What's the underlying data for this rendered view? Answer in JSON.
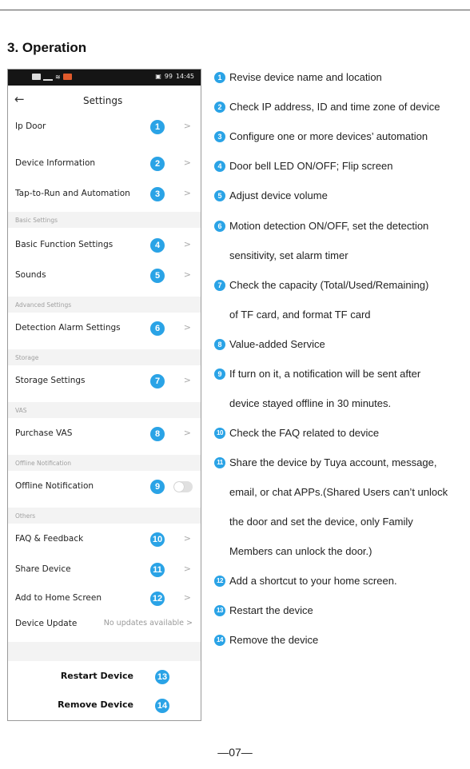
{
  "section_title": "3. Operation",
  "phone": {
    "status_time": "14:45",
    "status_battery": "99",
    "nav_back": "←",
    "nav_title": "Settings",
    "chevron": ">",
    "rows": {
      "ip_door": "Ip Door",
      "device_info": "Device Information",
      "tap_to_run": "Tap-to-Run and Automation",
      "basic_function": "Basic Function Settings",
      "sounds": "Sounds",
      "detection_alarm": "Detection Alarm Settings",
      "storage_settings": "Storage Settings",
      "purchase_vas": "Purchase VAS",
      "offline_notification": "Offline Notification",
      "faq_feedback": "FAQ & Feedback",
      "share_device": "Share Device",
      "add_home": "Add to Home Screen",
      "device_update": "Device Update",
      "device_update_value": "No updates available",
      "restart": "Restart Device",
      "remove": "Remove Device"
    },
    "sections": {
      "basic": "Basic Settings",
      "advanced": "Advanced Settings",
      "storage": "Storage",
      "vas": "VAS",
      "offline": "Offline Notification",
      "others": "Others"
    },
    "offline_toggle_on": false
  },
  "badge_color": "#2aa3e6",
  "badges": [
    "1",
    "2",
    "3",
    "4",
    "5",
    "6",
    "7",
    "8",
    "9",
    "10",
    "11",
    "12",
    "13",
    "14"
  ],
  "descriptions": [
    "Revise device name and location",
    "Check IP address, ID and time zone of device",
    "Configure one or more devices’ automation",
    "Door bell LED ON/OFF; Flip screen",
    "Adjust device volume",
    "Motion detection ON/OFF, set the detection",
    "sensitivity, set alarm timer",
    "Check the capacity (Total/Used/Remaining)",
    "of TF card, and format TF card",
    "Value-added Service",
    "If turn on it, a notification will be sent after",
    "device stayed offline in 30 minutes.",
    "Check the FAQ related to device",
    "Share the device by Tuya account, message,",
    "email, or chat APPs.(Shared Users can’t unlock",
    "the door and set the device, only Family",
    "Members can unlock the door.)",
    "Add a shortcut to your home screen.",
    "Restart the device",
    "Remove the device"
  ],
  "footer": "—07—"
}
